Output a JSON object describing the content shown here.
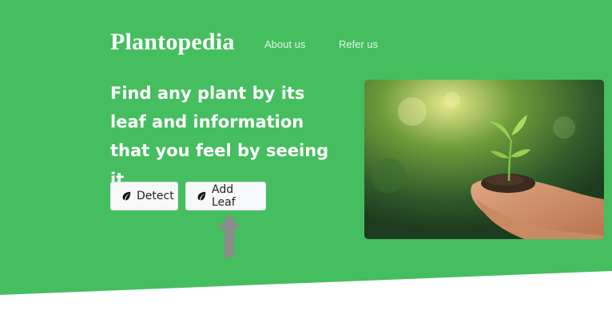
{
  "header": {
    "brand": "Plantopedia",
    "nav": [
      {
        "label": "About us"
      },
      {
        "label": "Refer us"
      }
    ]
  },
  "hero": {
    "headline": "Find any plant by its leaf and information that you feel by seeing it.",
    "buttons": [
      {
        "label": "Detect",
        "icon": "leaf-icon"
      },
      {
        "label": "Add Leaf",
        "icon": "leaf-icon"
      }
    ],
    "image": "seedling-in-hands-photo"
  },
  "colors": {
    "hero_background": "#45be5f",
    "text": "#ffffff",
    "button_background": "#f7f8f9",
    "arrow": "#888888"
  }
}
